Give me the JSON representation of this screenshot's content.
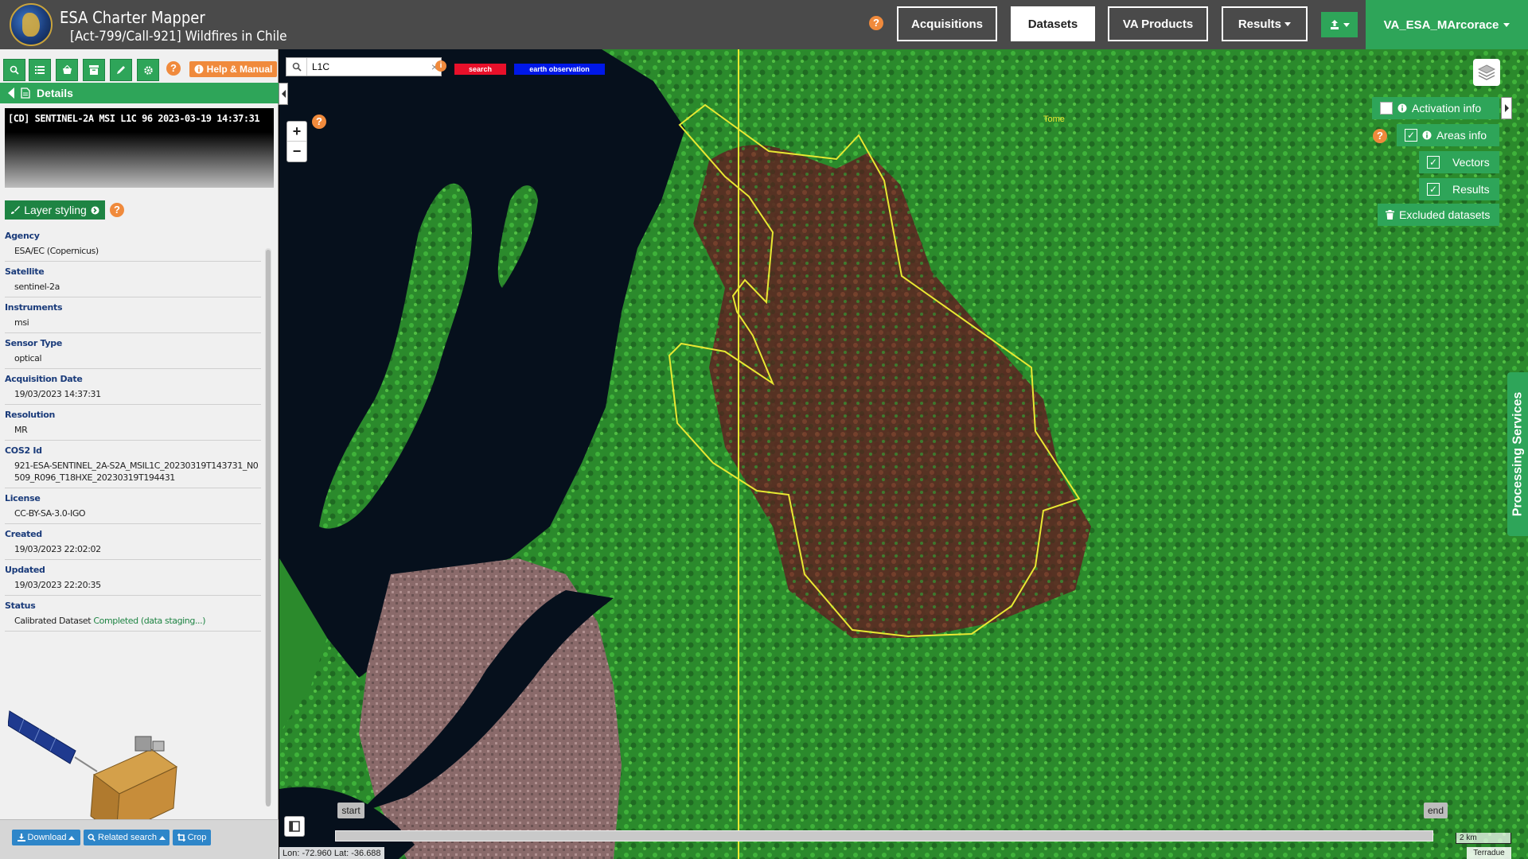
{
  "header": {
    "app_title": "ESA Charter Mapper",
    "activation_title": "[Act-799/Call-921] Wildfires in Chile",
    "help": "?",
    "nav": {
      "acquisitions": "Acquisitions",
      "datasets": "Datasets",
      "va_products": "VA Products",
      "results": "Results"
    },
    "user": "VA_ESA_MArcorace"
  },
  "left_panel": {
    "help": "?",
    "help_manual": "Help & Manual",
    "details": "Details",
    "product_title": "[CD] SENTINEL-2A MSI L1C 96 2023-03-19 14:37:31",
    "layer_styling": "Layer styling",
    "properties": [
      {
        "key": "Agency",
        "value": "ESA/EC (Copernicus)"
      },
      {
        "key": "Satellite",
        "value": "sentinel-2a"
      },
      {
        "key": "Instruments",
        "value": "msi"
      },
      {
        "key": "Sensor Type",
        "value": "optical"
      },
      {
        "key": "Acquisition Date",
        "value": "19/03/2023 14:37:31"
      },
      {
        "key": "Resolution",
        "value": "MR"
      },
      {
        "key": "COS2 Id",
        "value": "921-ESA-SENTINEL_2A-S2A_MSIL1C_20230319T143731_N0509_R096_T18HXE_20230319T194431"
      },
      {
        "key": "License",
        "value": "CC-BY-SA-3.0-IGO"
      },
      {
        "key": "Created",
        "value": "19/03/2023 22:02:02"
      },
      {
        "key": "Updated",
        "value": "19/03/2023 22:20:35"
      }
    ],
    "status": {
      "key": "Status",
      "value": "Calibrated Dataset",
      "state": "Completed (data staging...)"
    },
    "actions": {
      "download": "Download",
      "related_search": "Related search",
      "crop": "Crop"
    }
  },
  "map": {
    "search_value": "L1C",
    "tags": [
      "search",
      "earth observation"
    ],
    "zoom_in": "+",
    "zoom_out": "−",
    "help": "?",
    "overlay": {
      "activation_info": "Activation info",
      "areas_info": "Areas info",
      "vectors": "Vectors",
      "results": "Results",
      "excluded_datasets": "Excluded datasets"
    },
    "processing_services": "Processing Services",
    "timeline": {
      "start": "start",
      "end": "end"
    },
    "coords": "Lon: -72.960 Lat: -36.688",
    "scale": "2 km",
    "attribution": "Terradue",
    "place_label": "Tome"
  },
  "colors": {
    "brand_green": "#2ea559",
    "topbar": "#4a4a4a",
    "help_orange": "#f08a3c",
    "tag_search": "#e8102a",
    "tag_eo": "#0018e8",
    "aoi_outline": "#e8e832"
  }
}
